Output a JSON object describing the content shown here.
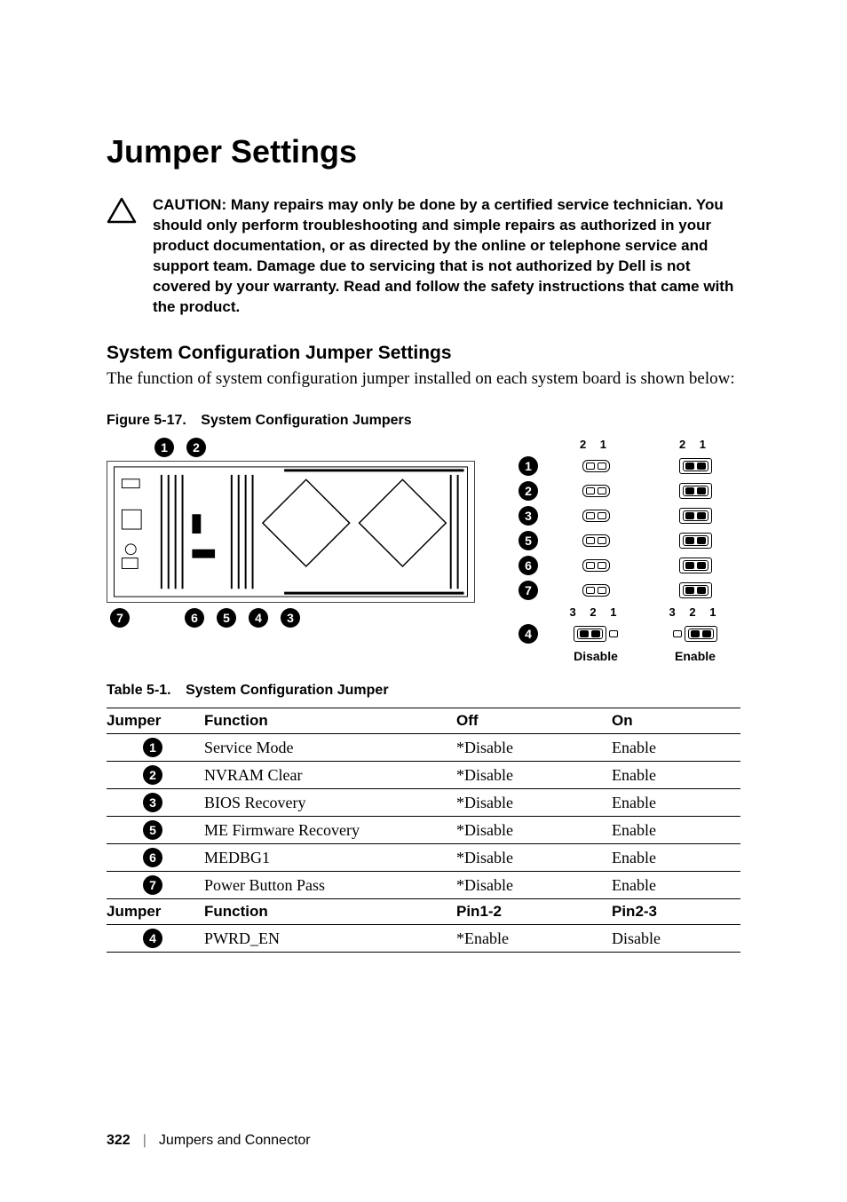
{
  "title": "Jumper Settings",
  "caution": "CAUTION: Many repairs may only be done by a certified service technician. You should only perform troubleshooting and simple repairs as authorized in your product documentation, or as directed by the online or telephone service and support team. Damage due to servicing that is not authorized by Dell is not covered by your warranty. Read and follow the safety instructions that came with the product.",
  "section_heading": "System Configuration Jumper Settings",
  "section_body": "The function of system configuration jumper installed on each system board is shown below:",
  "figure": {
    "label": "Figure 5-17.",
    "title": "System Configuration Jumpers"
  },
  "callouts_top": [
    "1",
    "2"
  ],
  "callouts_bottom": [
    "7",
    "6",
    "5",
    "4",
    "3"
  ],
  "legend": {
    "head_left": "2  1",
    "head_right": "2  1",
    "rows2pin": [
      "1",
      "2",
      "3",
      "5",
      "6",
      "7"
    ],
    "row3pin": "4",
    "mid_left": "3  2  1",
    "mid_right": "3  2  1",
    "foot_left": "Disable",
    "foot_right": "Enable"
  },
  "table": {
    "label": "Table 5-1.",
    "title": "System Configuration Jumper",
    "headers1": {
      "jumper": "Jumper",
      "function": "Function",
      "off": "Off",
      "on": "On"
    },
    "rows1": [
      {
        "badge": "1",
        "function": "Service Mode",
        "off": "*Disable",
        "on": "Enable"
      },
      {
        "badge": "2",
        "function": "NVRAM Clear",
        "off": "*Disable",
        "on": "Enable"
      },
      {
        "badge": "3",
        "function": "BIOS Recovery",
        "off": "*Disable",
        "on": "Enable"
      },
      {
        "badge": "5",
        "function": "ME Firmware Recovery",
        "off": "*Disable",
        "on": "Enable"
      },
      {
        "badge": "6",
        "function": "MEDBG1",
        "off": "*Disable",
        "on": "Enable"
      },
      {
        "badge": "7",
        "function": "Power Button Pass",
        "off": "*Disable",
        "on": "Enable"
      }
    ],
    "headers2": {
      "jumper": "Jumper",
      "function": "Function",
      "c1": "Pin1-2",
      "c2": "Pin2-3"
    },
    "rows2": [
      {
        "badge": "4",
        "function": "PWRD_EN",
        "c1": "*Enable",
        "c2": "Disable"
      }
    ]
  },
  "footer": {
    "page": "322",
    "section": "Jumpers and Connector"
  }
}
